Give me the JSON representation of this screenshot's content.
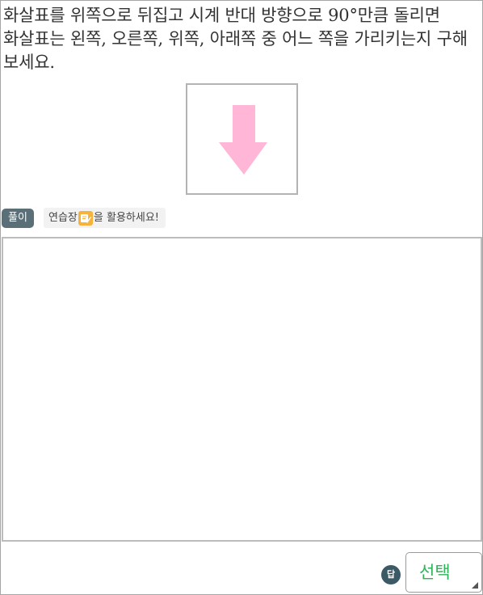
{
  "question": {
    "text": "화살표를 위쪽으로 뒤집고 시계 반대 방향으로 90°만큼 돌리면 화살표는 왼쪽, 오른쪽, 위쪽, 아래쪽 중 어느 쪽을 가리키는지 구해 보세요."
  },
  "figure": {
    "arrow_direction": "down",
    "arrow_color": "#ffb6d7",
    "border_color": "#b3b3b3"
  },
  "solution": {
    "badge_label": "풀이",
    "hint_before": "연습장",
    "hint_after": "을 활용하세요!",
    "pad_icon": "pencil-note-icon"
  },
  "answer": {
    "badge_label": "답",
    "select_label": "선택",
    "select_color": "#2fb35a"
  }
}
